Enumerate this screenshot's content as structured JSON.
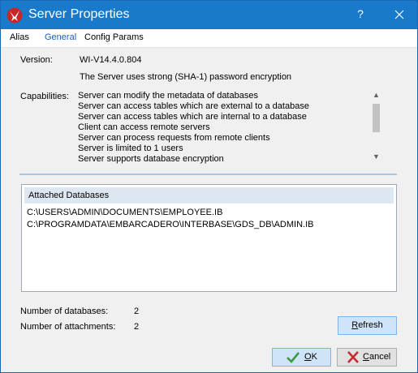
{
  "window": {
    "title": "Server Properties",
    "help_label": "?"
  },
  "tabs": [
    {
      "label": "Alias"
    },
    {
      "label": "General",
      "active": true
    },
    {
      "label": "Config Params"
    }
  ],
  "general": {
    "version_label": "Version:",
    "version_value": "WI-V14.4.0.804",
    "encryption_note": "The Server uses strong (SHA-1) password encryption",
    "capabilities_label": "Capabilities:",
    "capabilities": [
      "Server can modify the metadata of databases",
      "Server can access tables which are external to a database",
      "Server can access tables which are internal to a database",
      "Client can access remote servers",
      "Server can process requests from remote clients",
      "Server is limited to 1 users",
      "Server supports database encryption"
    ]
  },
  "attached": {
    "header": "Attached Databases",
    "rows": [
      "C:\\USERS\\ADMIN\\DOCUMENTS\\EMPLOYEE.IB",
      "C:\\PROGRAMDATA\\EMBARCADERO\\INTERBASE\\GDS_DB\\ADMIN.IB"
    ]
  },
  "stats": {
    "num_databases_label": "Number of databases:",
    "num_databases_value": "2",
    "num_attachments_label": "Number of attachments:",
    "num_attachments_value": "2"
  },
  "buttons": {
    "refresh_first": "R",
    "refresh_rest": "efresh",
    "ok_first": "O",
    "ok_rest": "K",
    "cancel_first": "C",
    "cancel_rest": "ancel"
  },
  "colors": {
    "titlebar": "#1979ca",
    "accent": "#1a5fb4",
    "ok_check": "#3c9a3c",
    "cancel_x": "#c8282e"
  }
}
